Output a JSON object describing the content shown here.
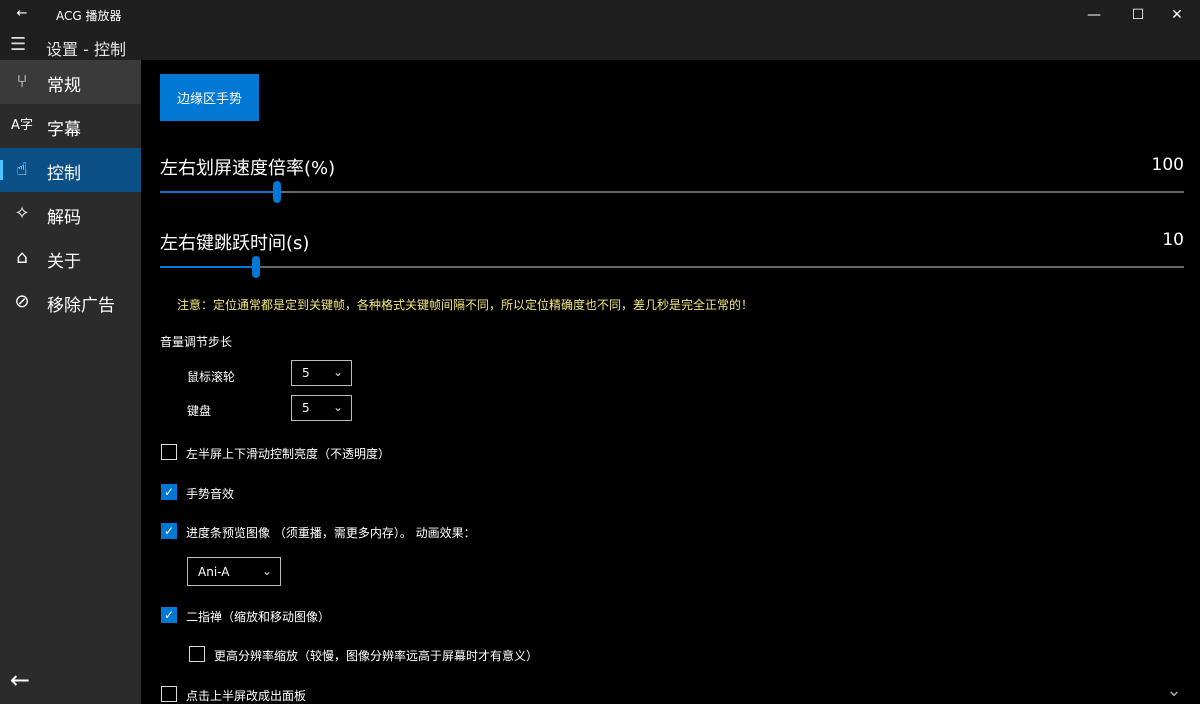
{
  "titlebar": {
    "back_icon": "←",
    "app_title": "ACG 播放器",
    "minimize": "—",
    "maximize": "☐",
    "close": "✕"
  },
  "header": {
    "menu_icon": "☰",
    "title": "设置 - 控制"
  },
  "sidebar": {
    "items": [
      {
        "icon": "⑂",
        "label": "常规"
      },
      {
        "icon": "A字",
        "label": "字幕"
      },
      {
        "icon": "☝",
        "label": "控制"
      },
      {
        "icon": "✧",
        "label": "解码"
      },
      {
        "icon": "⌂",
        "label": "关于"
      },
      {
        "icon": "⊘",
        "label": "移除广告"
      }
    ],
    "back_icon": "←"
  },
  "main": {
    "edge_gesture_button": "边缘区手势",
    "swipe_speed": {
      "label": "左右划屏速度倍率(%)",
      "value": "100",
      "fill": 0.114
    },
    "jump_time": {
      "label": "左右键跳跃时间(s)",
      "value": "10",
      "fill": 0.094
    },
    "note": "注意：定位通常都是定到关键帧，各种格式关键帧间隔不同，所以定位精确度也不同，差几秒是完全正常的！",
    "volume_step": {
      "label": "音量调节步长",
      "mouse_label": "鼠标滚轮",
      "mouse_value": "5",
      "keyboard_label": "键盘",
      "keyboard_value": "5"
    },
    "checkboxes": {
      "left_brightness": "左半屏上下滑动控制亮度（不透明度）",
      "gesture_sound": "手势音效",
      "preview": "进度条预览图像 （须重播，需更多内存）。 动画效果：",
      "two_finger": "二指禅（缩放和移动图像）",
      "high_res": "更高分辨率缩放（较慢，图像分辨率远高于屏幕时才有意义）",
      "top_half": "点击上半屏改成出面板"
    },
    "animation_value": "Ani-A",
    "chevron": "⌄",
    "check_mark": "✓"
  }
}
